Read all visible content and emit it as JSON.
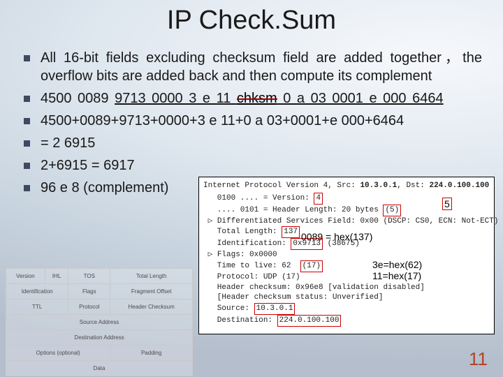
{
  "title": "IP Check.Sum",
  "bullets": {
    "b0": "All 16-bit fields excluding checksum field are added together，the overflow bits are added back and then compute its complement",
    "hex": {
      "a": "4500 0089 ",
      "b": "9713 0000 3 e 11 ",
      "c": "chksm",
      "d": " 0 a 03 0001 ",
      "e": "e 000 6464"
    },
    "b1": "4500+0089+9713+0000+3 e 11+0 a 03+0001+e 000+6464",
    "b2": "= 2 6915",
    "b3": "2+6915 = 6917",
    "b4": "96 e 8 (complement)"
  },
  "inset": {
    "header": {
      "pre": "Internet Protocol Version 4, Src: ",
      "src": "10.3.0.1",
      "mid": ", Dst: ",
      "dst": "224.0.100.100"
    },
    "l1a": "   0100 .... = Version: ",
    "l1b": "4",
    "l2a": "   .... 0101 = Header Length: 20 bytes ",
    "l2b": "(5)",
    "l3": " ▷ Differentiated Services Field: 0x00 (DSCP: CS0, ECN: Not-ECT)",
    "l4a": "   Total Length: ",
    "l4b": "137",
    "l5a": "   Identification: ",
    "l5b": "0x9713",
    "l5c": " (38675)",
    "l6": " ▷ Flags: 0x0000",
    "l7a": "   Time to live: 62  ",
    "l7b": "(17)",
    "l8a": "   Protocol: UDP (17)",
    "l9": "   Header checksum: 0x96e8 [validation disabled]",
    "l10": "   [Header checksum status: Unverified]",
    "l11a": "   Source: ",
    "l11b": "10.3.0.1",
    "l12a": "   Destination: ",
    "l12b": "224.0.100.100"
  },
  "ann": {
    "a1": "5",
    "a2": "0089 = hex(137)",
    "a3": "3e=hex(62)",
    "a4": "11=hex(17)"
  },
  "tbl": {
    "r1": [
      "Version",
      "IHL",
      "TOS",
      "Total Length"
    ],
    "r2": [
      "Identification",
      "Flags",
      "Fragment Offset"
    ],
    "r3": [
      "TTL",
      "Protocol",
      "Header Checksum"
    ],
    "r4": "Source Address",
    "r5": "Destination Address",
    "r6": [
      "Options (optional)",
      "Padding"
    ],
    "r7": "Data"
  },
  "page": "11"
}
